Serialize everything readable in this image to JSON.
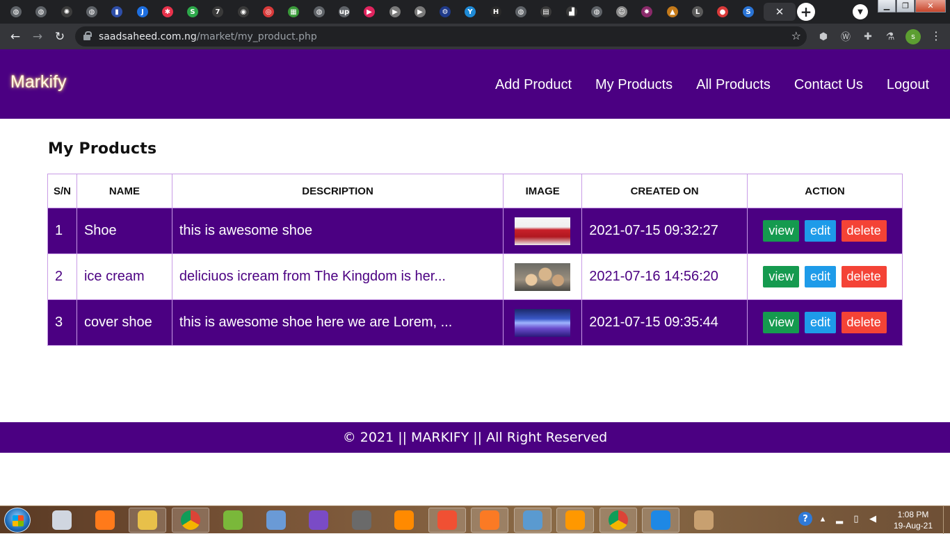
{
  "browser": {
    "url_host": "saadsaheed.com.ng",
    "url_path": "/market/my_product.php",
    "tab_favicons": [
      {
        "icon": "globe-icon",
        "color": "#5f6368",
        "glyph": "◍"
      },
      {
        "icon": "globe-icon",
        "color": "#5f6368",
        "glyph": "◍"
      },
      {
        "icon": "openai-icon",
        "color": "#3c3c3c",
        "glyph": "✺"
      },
      {
        "icon": "globe-icon",
        "color": "#5f6368",
        "glyph": "◍"
      },
      {
        "icon": "bookmark-icon",
        "color": "#2e4ea8",
        "glyph": "▮"
      },
      {
        "icon": "jira-icon",
        "color": "#1e6fe0",
        "glyph": "J"
      },
      {
        "icon": "asterisk-icon",
        "color": "#e8324b",
        "glyph": "✱"
      },
      {
        "icon": "dollar-icon",
        "color": "#2da84a",
        "glyph": "S"
      },
      {
        "icon": "seven-icon",
        "color": "#3a3a3a",
        "glyph": "7"
      },
      {
        "icon": "github-icon",
        "color": "#3a3a3a",
        "glyph": "◉"
      },
      {
        "icon": "target-icon",
        "color": "#d93a3a",
        "glyph": "◎"
      },
      {
        "icon": "game-icon",
        "color": "#3a9a3a",
        "glyph": "▦"
      },
      {
        "icon": "globe-icon",
        "color": "#5f6368",
        "glyph": "◍"
      },
      {
        "icon": "upwork-icon",
        "color": "#5f6368",
        "glyph": "up"
      },
      {
        "icon": "play-icon",
        "color": "#e0245e",
        "glyph": "▶"
      },
      {
        "icon": "play-icon",
        "color": "#7a7a7a",
        "glyph": "▶"
      },
      {
        "icon": "play-icon",
        "color": "#7a7a7a",
        "glyph": "▶"
      },
      {
        "icon": "gear-icon",
        "color": "#1f3a8a",
        "glyph": "⚙"
      },
      {
        "icon": "y-icon",
        "color": "#1e8ad6",
        "glyph": "Y"
      },
      {
        "icon": "h-icon",
        "color": "#2a2a2a",
        "glyph": "H"
      },
      {
        "icon": "globe-icon",
        "color": "#5f6368",
        "glyph": "◍"
      },
      {
        "icon": "bag-icon",
        "color": "#3a3a3a",
        "glyph": "▤"
      },
      {
        "icon": "chart-icon",
        "color": "#3a3a3a",
        "glyph": "▟"
      },
      {
        "icon": "globe-icon",
        "color": "#5f6368",
        "glyph": "◍"
      },
      {
        "icon": "avatar-icon",
        "color": "#8a8a8a",
        "glyph": "☺"
      },
      {
        "icon": "burst-icon",
        "color": "#8a2a6a",
        "glyph": "✸"
      },
      {
        "icon": "triangle-icon",
        "color": "#c47a1a",
        "glyph": "▲"
      },
      {
        "icon": "laravel-icon",
        "color": "#5a5a5a",
        "glyph": "L"
      },
      {
        "icon": "record-icon",
        "color": "#d93a3a",
        "glyph": "●"
      },
      {
        "icon": "stripe-icon",
        "color": "#2a74d6",
        "glyph": "S"
      }
    ],
    "profile_initial": "s"
  },
  "site": {
    "brand": "Markify",
    "nav": [
      "Add Product",
      "My Products",
      "All Products",
      "Contact Us",
      "Logout"
    ],
    "page_title": "My Products",
    "table": {
      "columns": [
        "S/N",
        "NAME",
        "DESCRIPTION",
        "IMAGE",
        "CREATED ON",
        "ACTION"
      ],
      "rows": [
        {
          "sn": "1",
          "name": "Shoe",
          "description": "this is awesome shoe",
          "created_on": "2021-07-15 09:32:27"
        },
        {
          "sn": "2",
          "name": "ice cream",
          "description": "deliciuos icream from The Kingdom is her...",
          "created_on": "2021-07-16 14:56:20"
        },
        {
          "sn": "3",
          "name": "cover shoe",
          "description": "this is awesome shoe here we are Lorem, ...",
          "created_on": "2021-07-15 09:35:44"
        }
      ],
      "actions": {
        "view": "view",
        "edit": "edit",
        "delete": "delete"
      }
    },
    "footer": "© 2021 || MARKIFY || All Right Reserved",
    "colors": {
      "primary": "#4b0082",
      "view": "#159a4f",
      "edit": "#1e9be9",
      "delete": "#f44336"
    }
  },
  "taskbar": {
    "apps": [
      "paint-icon",
      "firefox-icon",
      "file-explorer-icon",
      "chrome-icon",
      "chameleon-icon",
      "virtualbox-icon",
      "visual-studio-icon",
      "tree-icon",
      "vlc-icon",
      "git-icon",
      "xampp-icon",
      "photos-icon",
      "sublime-text-icon",
      "chrome-icon",
      "vscode-icon",
      "paint-palette-icon"
    ],
    "time": "1:08 PM",
    "date": "19-Aug-21"
  }
}
